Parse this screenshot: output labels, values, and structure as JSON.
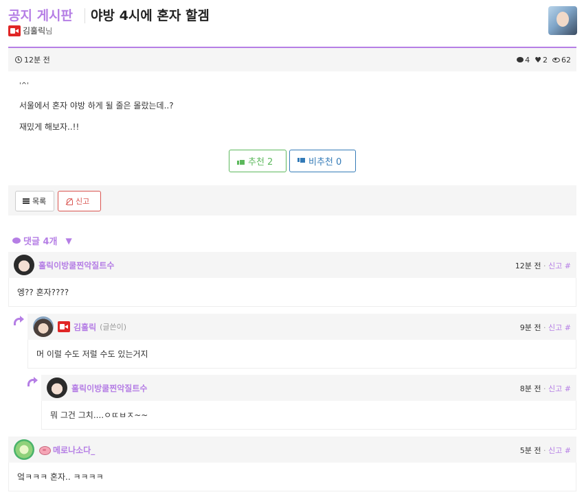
{
  "header": {
    "board_name": "공지 게시판",
    "title": "야방 4시에 혼자 할겜",
    "author": "김훌릭",
    "author_suffix": "님"
  },
  "post": {
    "time": "12분 전",
    "comment_count": "4",
    "like_count": "2",
    "view_count": "62",
    "body_lines": [
      "'^'",
      "서울에서 혼자 야방 하게 될 줄은 몰랐는데..?",
      "재밌게 해보자..!!"
    ],
    "upvote_label": "추천 2",
    "downvote_label": "비추천 0",
    "list_label": "목록",
    "report_label": "신고"
  },
  "comments_toggle": {
    "label": "댓글 4개"
  },
  "comments": [
    {
      "name": "훌릭이방쿨찐악질트수",
      "writer_tag": "",
      "time": "12분 전",
      "report": "신고",
      "hash": "#",
      "body": "엥?? 혼자????"
    },
    {
      "name": "김훌릭",
      "writer_tag": "(글쓴이)",
      "time": "9분 전",
      "report": "신고",
      "hash": "#",
      "body": "머 이럴 수도 저럴 수도 있는거지"
    },
    {
      "name": "훌릭이방쿨찐악질트수",
      "writer_tag": "",
      "time": "8분 전",
      "report": "신고",
      "hash": "#",
      "body": "뭐 그건 그치....ㅇㄸㅂㅈ~~"
    },
    {
      "name": "메로나소다_",
      "writer_tag": "",
      "time": "5분 전",
      "report": "신고",
      "hash": "#",
      "body": "엌ㅋㅋㅋ 혼자.. ㅋㅋㅋㅋ"
    }
  ],
  "colors": {
    "accent": "#b57ee5",
    "upvote": "#5cb85c",
    "downvote": "#337ab7",
    "report": "#d9534f"
  }
}
